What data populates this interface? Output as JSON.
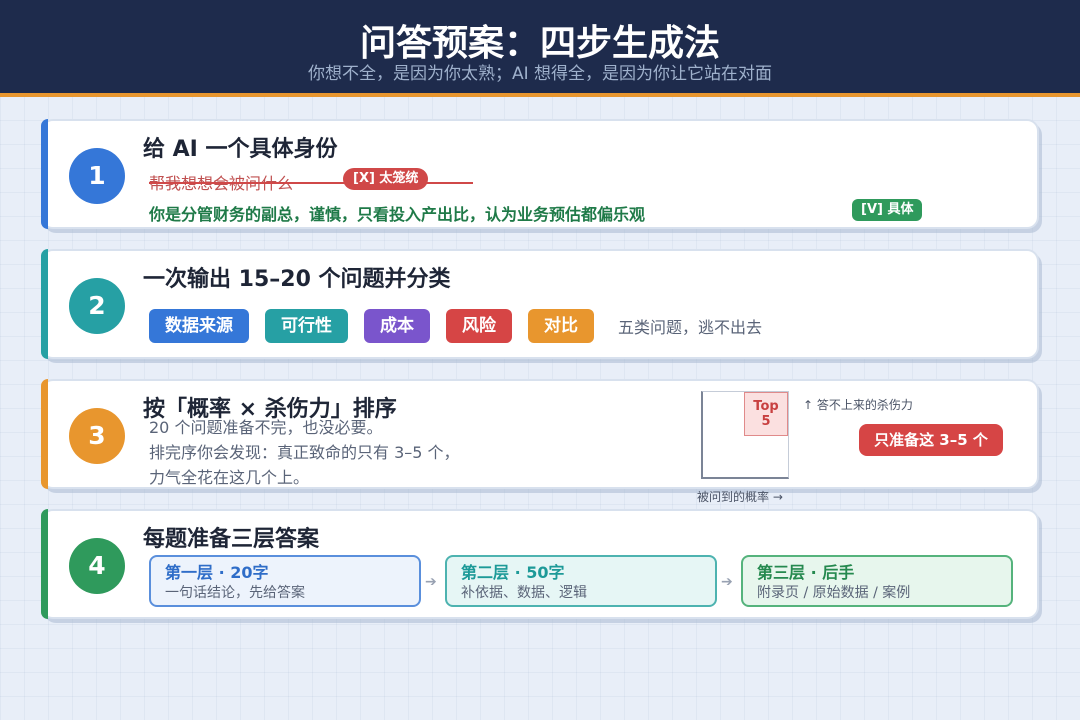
{
  "header": {
    "title": "问答预案：四步生成法",
    "subtitle": "你想不全，是因为你太熟；AI 想得全，是因为你让它站在对面"
  },
  "steps": [
    {
      "number": "1",
      "title": "给 AI 一个具体身份",
      "bad_example": "帮我想想会被问什么",
      "bad_badge": "[X] 太笼统",
      "good_example": "你是分管财务的副总，谨慎，只看投入产出比，认为业务预估都偏乐观",
      "good_badge": "[V] 具体"
    },
    {
      "number": "2",
      "title": "一次输出 15–20 个问题并分类",
      "tags": [
        "数据来源",
        "可行性",
        "成本",
        "风险",
        "对比"
      ],
      "tag_note": "五类问题，逃不出去"
    },
    {
      "number": "3",
      "title": "按「概率 × 杀伤力」排序",
      "body_lines": [
        "20 个问题准备不完，也没必要。",
        "排完序你会发现：真正致命的只有 3–5 个，",
        "力气全花在这几个上。"
      ],
      "matrix_highlight": "Top\n5",
      "y_axis_label": "↑ 答不上来的杀伤力",
      "x_axis_label": "被问到的概率 →",
      "badge": "只准备这 3–5 个"
    },
    {
      "number": "4",
      "title": "每题准备三层答案",
      "layers": [
        {
          "title": "第一层 · 20字",
          "desc": "一句话结论，先给答案"
        },
        {
          "title": "第二层 · 50字",
          "desc": "补依据、数据、逻辑"
        },
        {
          "title": "第三层 · 后手",
          "desc": "附录页 / 原始数据 / 案例"
        }
      ]
    }
  ],
  "colors": {
    "step1": "#3577d8",
    "step2": "#26a0a4",
    "step3": "#e8962e",
    "step4": "#2f9a5c",
    "tag_colors": [
      "#3577d8",
      "#26a0a4",
      "#7a55cc",
      "#d64545",
      "#e8962e"
    ],
    "danger": "#d64545",
    "header_bg": "#1e2b4c"
  }
}
